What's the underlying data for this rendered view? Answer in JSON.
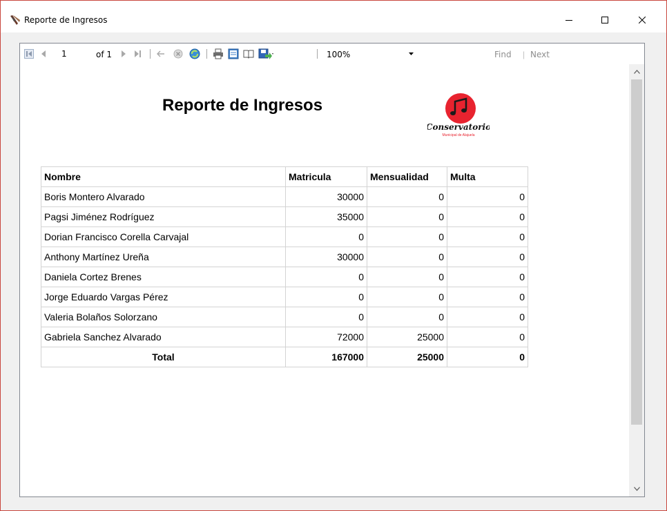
{
  "window": {
    "title": "Reporte de Ingresos"
  },
  "toolbar": {
    "current_page": "1",
    "of_label": "of 1",
    "zoom": "100%",
    "find_label": "Find",
    "find_sep": "|",
    "next_label": "Next",
    "icons": [
      "first-page-icon",
      "previous-page-icon",
      "next-page-icon",
      "last-page-icon",
      "back-icon",
      "stop-icon",
      "refresh-icon",
      "print-icon",
      "print-layout-icon",
      "page-setup-icon",
      "export-icon"
    ]
  },
  "report": {
    "title": "Reporte de Ingresos",
    "logo_text": "Conservatorio",
    "logo_subtext": "Municipal de Alajuela",
    "columns": [
      "Nombre",
      "Matricula",
      "Mensualidad",
      "Multa"
    ],
    "rows": [
      [
        "Boris Montero Alvarado",
        "30000",
        "0",
        "0"
      ],
      [
        "Pagsi Jiménez Rodríguez",
        "35000",
        "0",
        "0"
      ],
      [
        "Dorian Francisco Corella Carvajal",
        "0",
        "0",
        "0"
      ],
      [
        "Anthony Martínez Ureña",
        "30000",
        "0",
        "0"
      ],
      [
        "Daniela Cortez Brenes",
        "0",
        "0",
        "0"
      ],
      [
        "Jorge Eduardo Vargas Pérez",
        "0",
        "0",
        "0"
      ],
      [
        "Valeria Bolaños Solorzano",
        "0",
        "0",
        "0"
      ],
      [
        "Gabriela Sanchez Alvarado",
        "72000",
        "25000",
        "0"
      ]
    ],
    "total": [
      "Total",
      "167000",
      "25000",
      "0"
    ]
  },
  "colors": {
    "logo_red": "#e8232f",
    "window_border": "#c9463d",
    "scroll_thumb": "#cdcdcd"
  }
}
